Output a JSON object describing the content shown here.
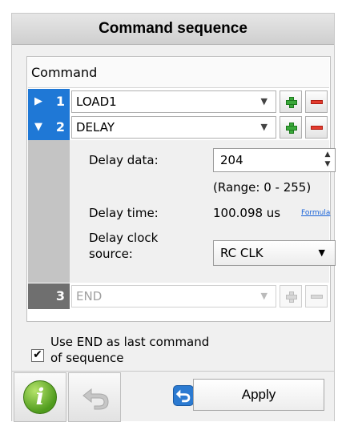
{
  "panel": {
    "title": "Command sequence"
  },
  "table": {
    "column_header": "Command"
  },
  "rows": [
    {
      "index": "1",
      "command": "LOAD1",
      "expanded": false
    },
    {
      "index": "2",
      "command": "DELAY",
      "expanded": true
    },
    {
      "index": "3",
      "command": "END",
      "disabled": true
    }
  ],
  "delay": {
    "data_label": "Delay data:",
    "data_value": "204",
    "range_text": "(Range:  0 - 255)",
    "time_label": "Delay time:",
    "time_value": "100.098 us",
    "formula_link": "Formula",
    "clock_label_line1": "Delay clock",
    "clock_label_line2": "source:",
    "clock_value": "RC CLK"
  },
  "options": {
    "use_end_line1": "Use END as last command",
    "use_end_line2": "of sequence",
    "use_end_checked": true,
    "check_mark": "✔"
  },
  "glyphs": {
    "expand_right": "▶",
    "expand_down": "▼",
    "caret": "▼",
    "spin_up": "▲",
    "spin_down": "▼",
    "info": "i"
  },
  "toolbar": {
    "apply_label": "Apply"
  },
  "colors": {
    "accent": "#1f78d6",
    "disabled_index": "#6f6f6f",
    "plus": "#3aa83a",
    "minus": "#e23b2e",
    "info": "#4f9b1d"
  }
}
